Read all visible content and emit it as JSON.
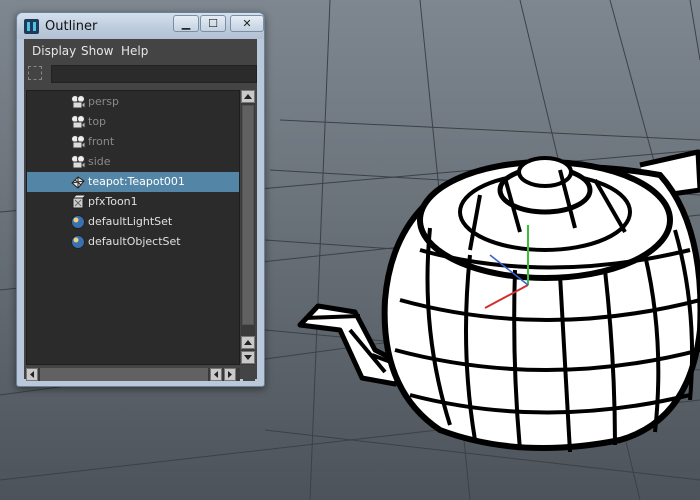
{
  "window": {
    "title": "Outliner",
    "controls": {
      "minimize": "▁",
      "maximize": "☐",
      "close": "✕"
    }
  },
  "menubar": {
    "items": [
      "Display",
      "Show",
      "Help"
    ]
  },
  "search": {
    "value": "",
    "placeholder": ""
  },
  "outliner": {
    "items": [
      {
        "label": "persp",
        "icon": "camera-icon",
        "dimmed": true,
        "selected": false
      },
      {
        "label": "top",
        "icon": "camera-icon",
        "dimmed": true,
        "selected": false
      },
      {
        "label": "front",
        "icon": "camera-icon",
        "dimmed": true,
        "selected": false
      },
      {
        "label": "side",
        "icon": "camera-icon",
        "dimmed": true,
        "selected": false
      },
      {
        "label": "teapot:Teapot001",
        "icon": "mesh-icon",
        "dimmed": false,
        "selected": true
      },
      {
        "label": "pfxToon1",
        "icon": "toon-icon",
        "dimmed": false,
        "selected": false
      },
      {
        "label": "defaultLightSet",
        "icon": "set-icon",
        "dimmed": false,
        "selected": false
      },
      {
        "label": "defaultObjectSet",
        "icon": "set-icon",
        "dimmed": false,
        "selected": false
      }
    ]
  },
  "colors": {
    "selection": "#5285a6",
    "viewport_bg": "#6b737b",
    "panel_bg": "#444444"
  }
}
